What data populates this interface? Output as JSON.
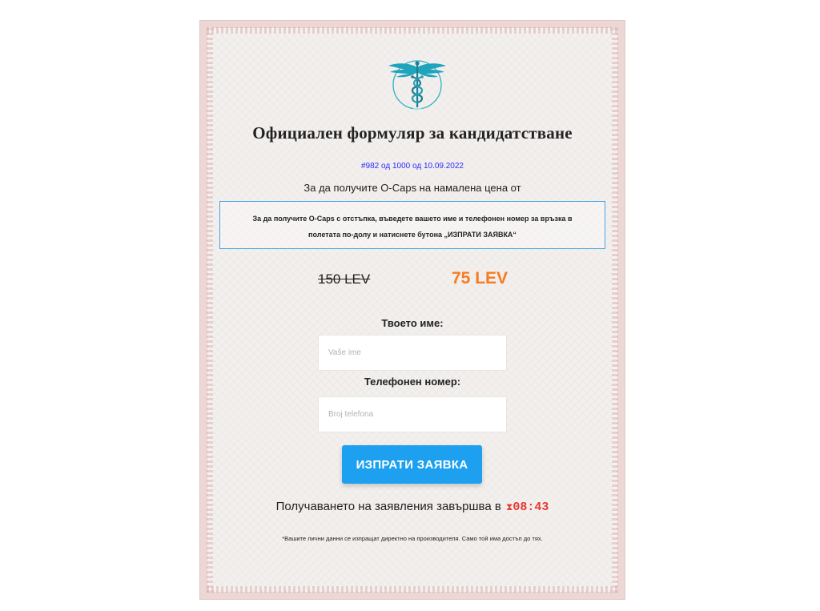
{
  "form": {
    "title": "Официален формуляр за кандидатстване",
    "order_line": "#982 од 1000 од 10.09.2022",
    "subtitle": "За да получите O-Caps на намалена цена от",
    "info_line1": "За да получите O-Caps с отстъпка, въведете вашето име и телефонен номер за връзка в",
    "info_line2": "полетата по-долу и натиснете бутона „ИЗПРАТИ ЗАЯВКА“",
    "old_price": "150 LEV",
    "new_price": "75 LEV",
    "name_label": "Твоето име:",
    "name_placeholder": "Vaše ime",
    "phone_label": "Телефонен номер:",
    "phone_placeholder": "Broj telefona",
    "submit_label": "ИЗПРАТИ ЗАЯВКА",
    "deadline_text": "Получаването на заявления завършва в",
    "deadline_icon": "hourglass-icon",
    "timer": "08:43",
    "disclaimer": "*Вашите лични данни се изпращат директно на производителя. Само той има достъп до тях."
  },
  "colors": {
    "accent": "#1ca0ef",
    "price_new": "#f57c1f",
    "timer": "#e53935",
    "order_line": "#2c2cff",
    "info_border": "#4aa4e3",
    "logo": "#2fb1c6"
  }
}
